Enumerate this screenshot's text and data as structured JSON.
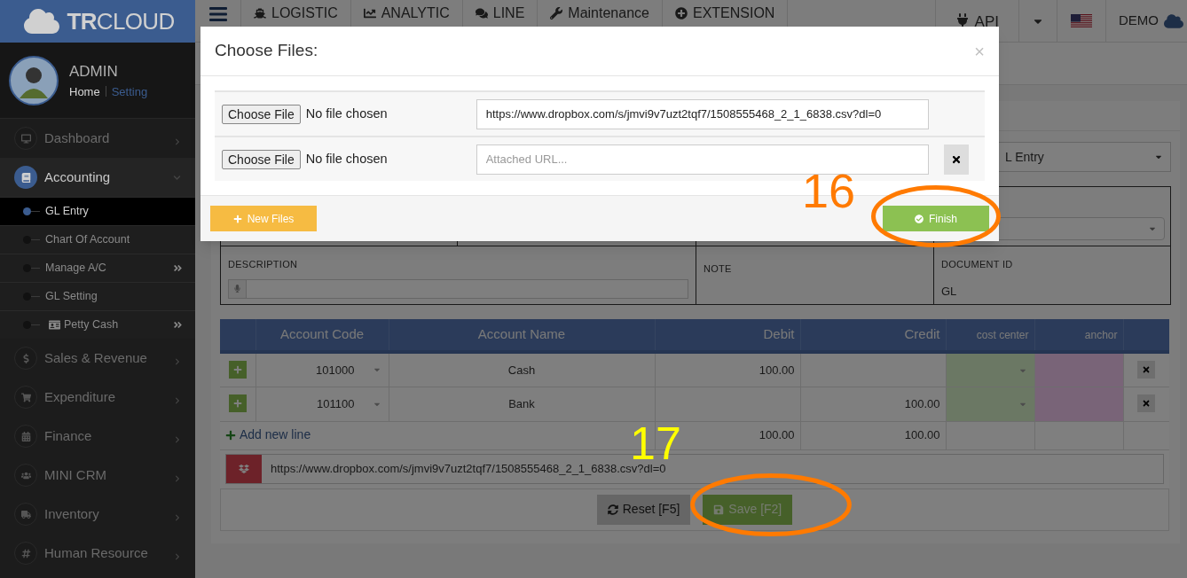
{
  "logo": {
    "text": "**TR**CLOUD"
  },
  "user": {
    "name": "ADMIN",
    "links": [
      {
        "label": "Home",
        "selected": true
      },
      {
        "label": "Setting",
        "selected": false
      }
    ]
  },
  "sidebar": {
    "items": [
      {
        "label": "Dashboard",
        "selected": false,
        "expanded": false
      },
      {
        "label": "Accounting",
        "selected": true,
        "expanded": true,
        "children": [
          {
            "label": "GL Entry",
            "selected": true,
            "submenu": false
          },
          {
            "label": "Chart Of Account",
            "selected": false,
            "submenu": false
          },
          {
            "label": "Manage A/C",
            "selected": false,
            "submenu": true
          },
          {
            "label": "GL Setting",
            "selected": false,
            "submenu": false
          },
          {
            "label": "Petty Cash",
            "selected": false,
            "submenu": true,
            "kind": "card"
          }
        ]
      },
      {
        "label": "Sales & Revenue",
        "selected": false,
        "expanded": false
      },
      {
        "label": "Expenditure",
        "selected": false,
        "expanded": false
      },
      {
        "label": "Finance",
        "selected": false,
        "expanded": false
      },
      {
        "label": "MINI CRM",
        "selected": false,
        "expanded": false
      },
      {
        "label": "Inventory",
        "selected": false,
        "expanded": false
      },
      {
        "label": "Human Resource",
        "selected": false,
        "expanded": false
      }
    ]
  },
  "topbar": {
    "nav": [
      "LOGISTIC",
      "ANALYTIC",
      "LINE",
      "Maintenance",
      "EXTENSION"
    ],
    "api": "API",
    "user": "DEMO"
  },
  "form": {
    "journal_select": "L Entry",
    "description_label": "DESCRIPTION",
    "note_label": "NOTE",
    "document_id_label": "DOCUMENT ID",
    "document_id": "GL"
  },
  "table": {
    "columns": [
      "Account Code",
      "Account Name",
      "Debit",
      "Credit",
      "cost center",
      "anchor"
    ],
    "rows": [
      {
        "code": "101000",
        "name": "Cash",
        "debit": "100.00",
        "credit": ""
      },
      {
        "code": "101100",
        "name": "Bank",
        "debit": "",
        "credit": "100.00"
      }
    ],
    "add_line": "Add new line",
    "total_debit": "100.00",
    "total_credit": "100.00"
  },
  "attachment": "https://www.dropbox.com/s/jmvi9v7uzt2tqf7/1508555468_2_1_6838.csv?dl=0",
  "buttons": {
    "reset": "Reset [F5]",
    "save": "Save [F2]"
  },
  "modal": {
    "title": "Choose Files:",
    "close": "×",
    "files": [
      {
        "button": "Choose File",
        "status": "No file chosen",
        "url": "https://www.dropbox.com/s/jmvi9v7uzt2tqf7/1508555468_2_1_6838.csv?dl=0",
        "removable": false
      },
      {
        "button": "Choose File",
        "status": "No file chosen",
        "placeholder": "Attached URL...",
        "removable": true
      }
    ],
    "new_files": "New Files",
    "finish": "Finish"
  },
  "annotations": [
    {
      "label": "16",
      "color": "#ff7a00"
    },
    {
      "label": "17",
      "color": "#ffff00"
    }
  ]
}
